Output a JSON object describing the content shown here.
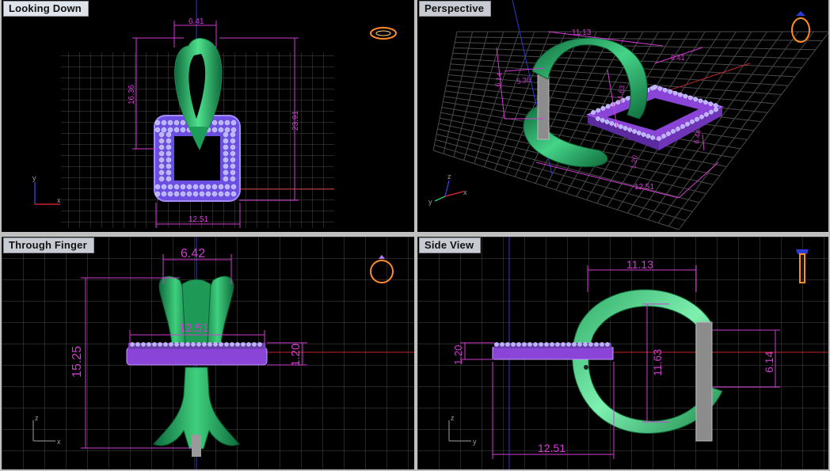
{
  "viewports": {
    "top_left": {
      "title": "Looking Down",
      "dims": {
        "width_top": "6.41",
        "height_left": "16.36",
        "height_right": "23.91",
        "width_bottom": "12.51"
      },
      "axes": {
        "v": "y",
        "h": "x"
      }
    },
    "top_right": {
      "title": "Perspective",
      "dims": {
        "a": "11.13",
        "b": "6.41",
        "c": "6.14",
        "d": "6.44",
        "e": "11.63",
        "f": "12.51",
        "g": "1.20",
        "h": "5.36"
      },
      "axes": {
        "v": "z",
        "h": "x",
        "d": "y"
      }
    },
    "bottom_left": {
      "title": "Through Finger",
      "dims": {
        "width_top": "6.42",
        "width_mid": "12.51",
        "height_left": "15.25",
        "thickness_right": "1.20"
      },
      "axes": {
        "v": "z",
        "h": "x"
      }
    },
    "bottom_right": {
      "title": "Side View",
      "dims": {
        "width_top": "11.13",
        "thickness_left": "1.20",
        "height_mid": "11.63",
        "height_right": "6.14",
        "width_bottom": "12.51"
      },
      "axes": {
        "v": "z",
        "h": "y"
      }
    }
  },
  "colors": {
    "grid": "#4a4a4a",
    "dimension": "#d23bd2",
    "band": "#2ecc71",
    "setting": "#9b3fd4",
    "stones": "#b9b4ff",
    "axis_red": "#c0262b",
    "axis_blue": "#2b3bd6"
  }
}
